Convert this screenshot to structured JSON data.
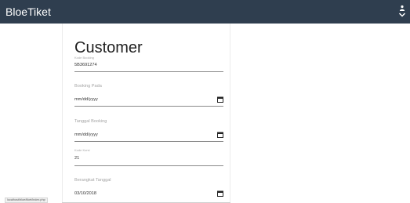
{
  "navbar": {
    "brand": "BloeTiket",
    "menu_icon": "user-chevron-icon",
    "background": "#2f3e4f"
  },
  "form": {
    "title": "Customer",
    "fields": [
      {
        "label": "Kode Booking",
        "value": "5B3691274",
        "type": "text"
      },
      {
        "label": "Booking Pada",
        "value": "mm/dd/yyyy",
        "type": "date"
      },
      {
        "label": "Tanggal Booking",
        "value": "mm/dd/yyyy",
        "type": "date"
      },
      {
        "label": "Kode Kursi",
        "value": "21",
        "type": "text"
      },
      {
        "label": "Berangkat Tanggal",
        "value": "03/10/2018",
        "type": "date"
      }
    ]
  },
  "status_bar": {
    "url": "localhost/bloe/tiket/index.php"
  }
}
